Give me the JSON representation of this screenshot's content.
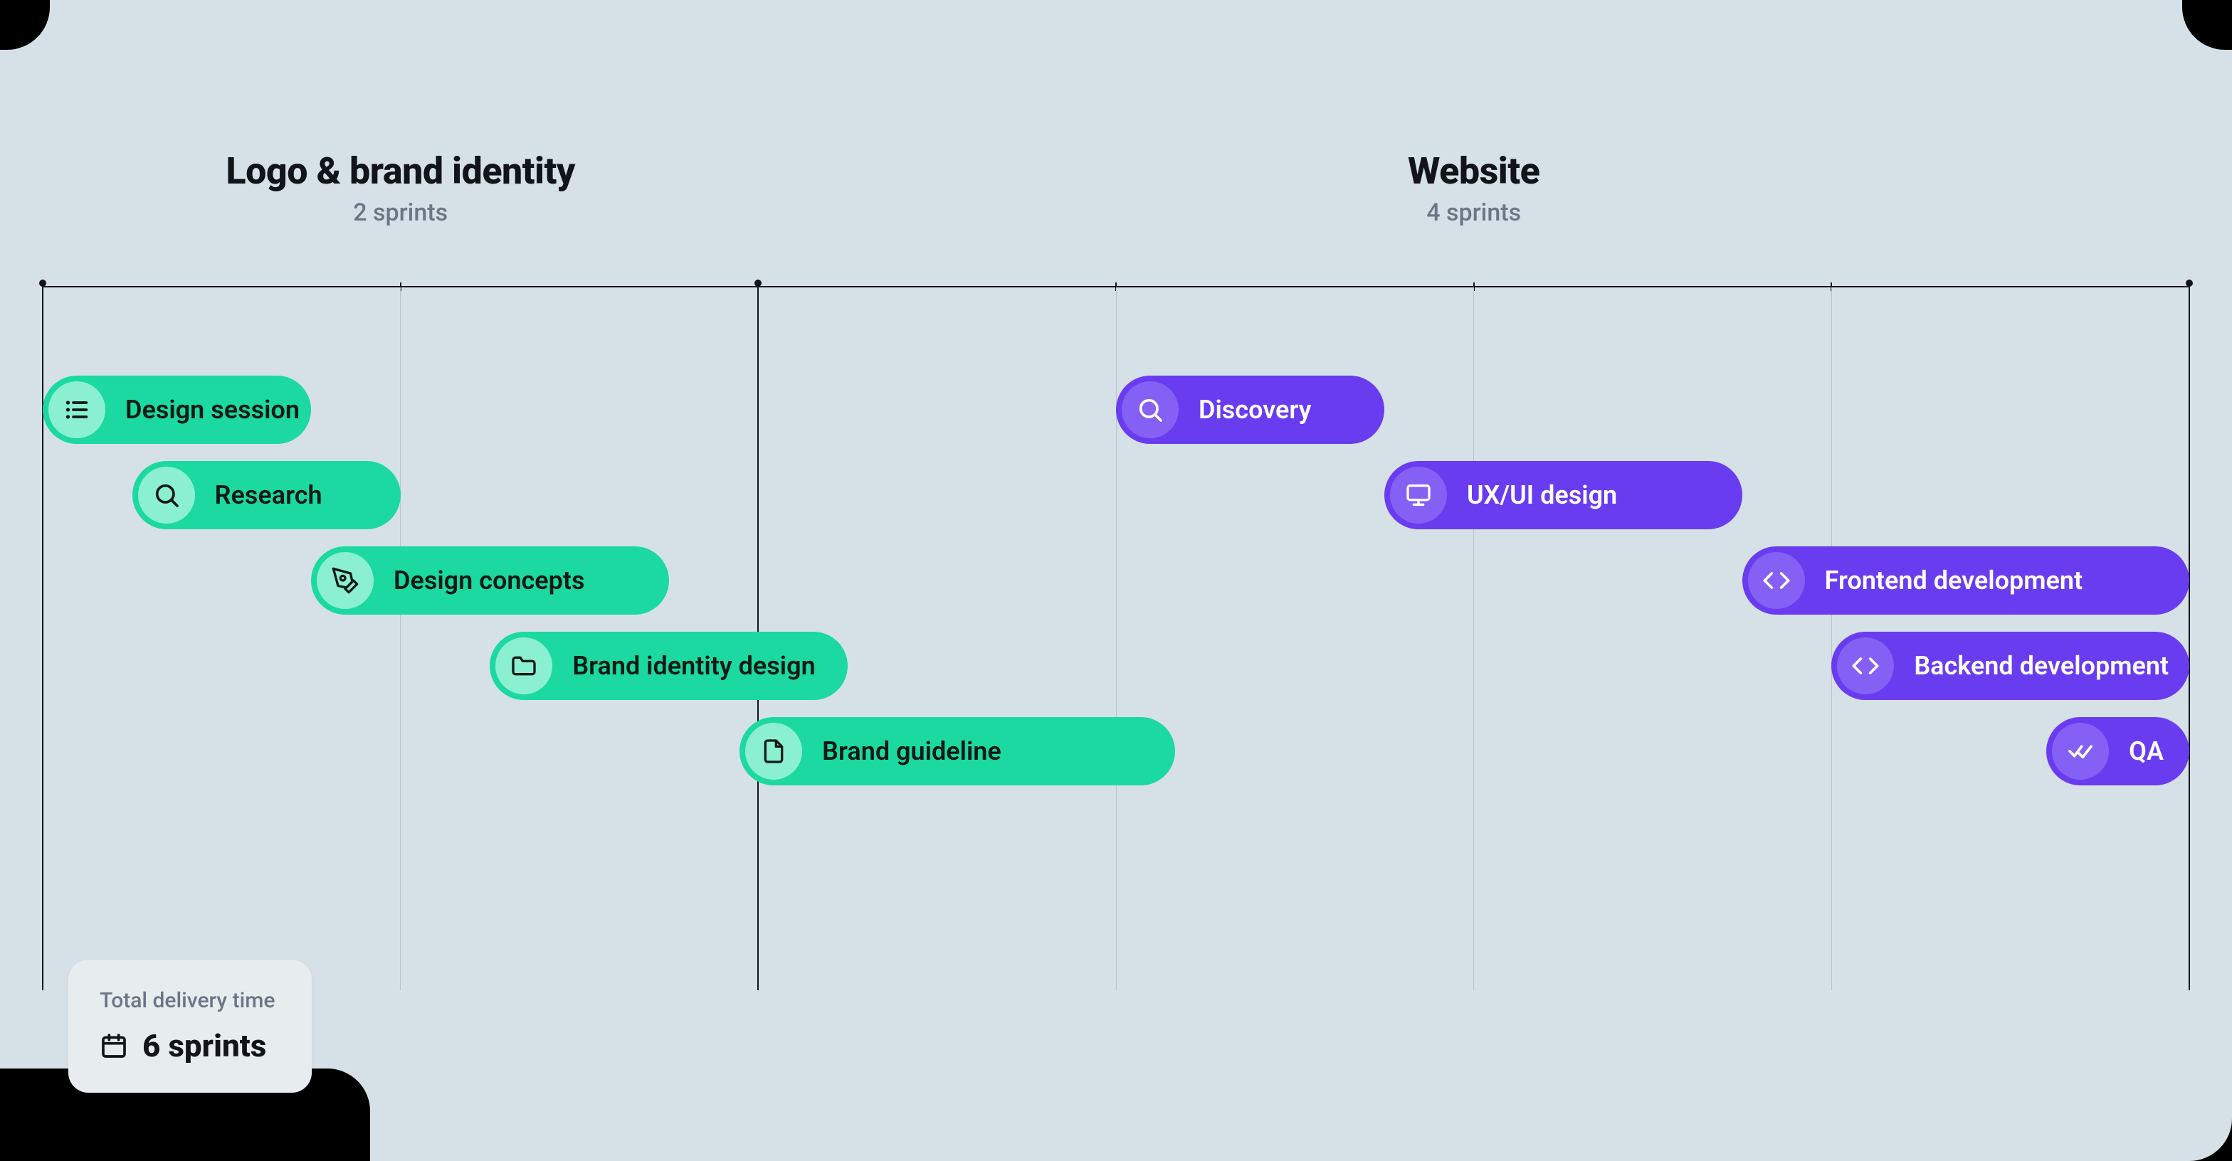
{
  "sections": [
    {
      "title": "Logo & brand identity",
      "sprints_label": "2 sprints",
      "span_cols": 8
    },
    {
      "title": "Website",
      "sprints_label": "4 sprints",
      "span_cols": 16
    }
  ],
  "grid_cols": 24,
  "tasks": [
    {
      "row": 0,
      "start": 0,
      "span": 3,
      "icon": "list",
      "color": "green",
      "label": "Design session"
    },
    {
      "row": 1,
      "start": 1,
      "span": 3,
      "icon": "search",
      "color": "green",
      "label": "Research"
    },
    {
      "row": 2,
      "start": 3,
      "span": 4,
      "icon": "pen",
      "color": "green",
      "label": "Design concepts"
    },
    {
      "row": 3,
      "start": 5,
      "span": 4,
      "icon": "folder",
      "color": "green",
      "label": "Brand identity design"
    },
    {
      "row": 4,
      "start": 8,
      "span": 5,
      "icon": "file",
      "color": "green",
      "label": "Brand guideline"
    },
    {
      "row": 0,
      "start": 12,
      "span": 3,
      "icon": "search",
      "color": "purple",
      "label": "Discovery"
    },
    {
      "row": 1,
      "start": 15,
      "span": 4,
      "icon": "monitor",
      "color": "purple",
      "label": "UX/UI design"
    },
    {
      "row": 2,
      "start": 19,
      "span": 5,
      "icon": "code",
      "color": "purple",
      "label": "Frontend development"
    },
    {
      "row": 3,
      "start": 20,
      "span": 5,
      "icon": "code",
      "color": "purple",
      "label": "Backend development"
    },
    {
      "row": 4,
      "start": 23,
      "span": 2,
      "icon": "check",
      "color": "purple",
      "label": "QA"
    }
  ],
  "timeline": {
    "majors": [
      0,
      2,
      6
    ],
    "minors": [
      1,
      3,
      4,
      5
    ],
    "sprint_units": 6
  },
  "summary": {
    "label": "Total delivery time",
    "value": "6 sprints"
  }
}
